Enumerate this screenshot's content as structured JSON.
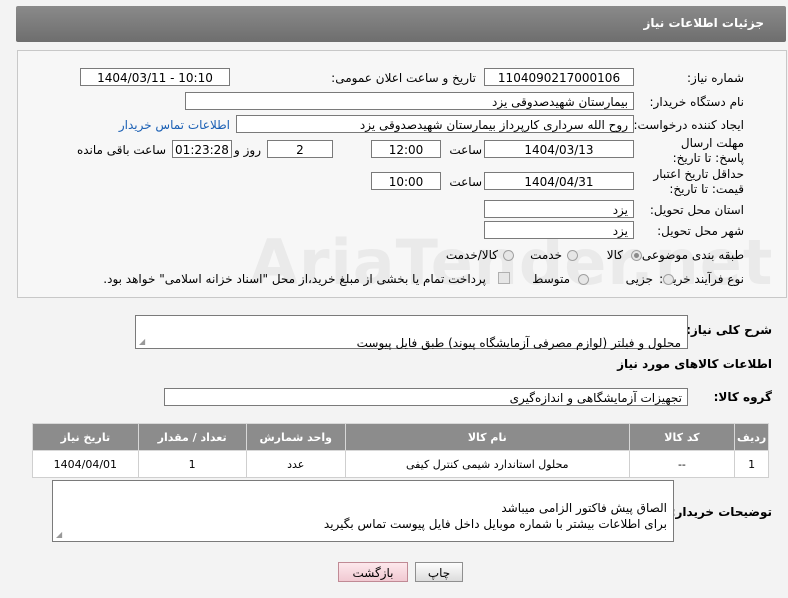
{
  "header": {
    "title": "جزئیات اطلاعات نیاز"
  },
  "form": {
    "need_number_label": "شماره نیاز:",
    "need_number": "1104090217000106",
    "announce_datetime_label": "تاریخ و ساعت اعلان عمومی:",
    "announce_datetime": "1404/03/11 - 10:10",
    "buyer_org_label": "نام دستگاه خریدار:",
    "buyer_org": "بیمارستان شهیدصدوقی یزد",
    "requester_label": "ایجاد کننده درخواست:",
    "requester": "روح الله سرداری کارپرداز بیمارستان شهیدصدوقی یزد",
    "buyer_contact_link": "اطلاعات تماس خریدار",
    "reply_deadline_label": "مهلت ارسال پاسخ: تا تاریخ:",
    "reply_date": "1404/03/13",
    "time_label": "ساعت",
    "reply_time": "12:00",
    "days_count": "2",
    "days_and_label": "روز و",
    "remaining_time": "01:23:28",
    "remaining_label": "ساعت باقی مانده",
    "price_validity_label": "حداقل تاریخ اعتبار قیمت: تا تاریخ:",
    "validity_date": "1404/04/31",
    "validity_time": "10:00",
    "province_label": "استان محل تحویل:",
    "province": "یزد",
    "city_label": "شهر محل تحویل:",
    "city": "یزد",
    "category_label": "طبقه بندی موضوعی:",
    "category_options": [
      "کالا",
      "خدمت",
      "کالا/خدمت"
    ],
    "purchase_type_label": "نوع فرآیند خرید :",
    "purchase_types": [
      "جزیی",
      "متوسط"
    ],
    "payment_note": "پرداخت تمام یا بخشی از مبلغ خرید،از محل \"اسناد خزانه اسلامی\" خواهد بود."
  },
  "description": {
    "label": "شرح کلی نیاز:",
    "text": "محلول و فیلتر (لوازم مصرفی آزمایشگاه پیوند) طبق فایل پیوست"
  },
  "goods_section": {
    "title": "اطلاعات کالاهای مورد نیاز",
    "group_label": "گروه کالا:",
    "group_value": "تجهیزات آزمایشگاهی و اندازه‌گیری"
  },
  "table": {
    "columns": [
      "ردیف",
      "کد کالا",
      "نام کالا",
      "واحد شمارش",
      "تعداد / مقدار",
      "تاریخ نیاز"
    ],
    "rows": [
      [
        "1",
        "--",
        "محلول استاندارد شیمی کنترل کیفی",
        "عدد",
        "1",
        "1404/04/01"
      ]
    ]
  },
  "buyer_notes": {
    "label": "توضیحات خریدار:",
    "text": "الصاق پیش فاکتور الزامی میباشد\nبرای اطلاعات بیشتر با شماره موبایل داخل  فایل پیوست تماس بگیرید"
  },
  "buttons": {
    "print": "چاپ",
    "back": "بازگشت"
  },
  "watermark": "AriaTender.net"
}
